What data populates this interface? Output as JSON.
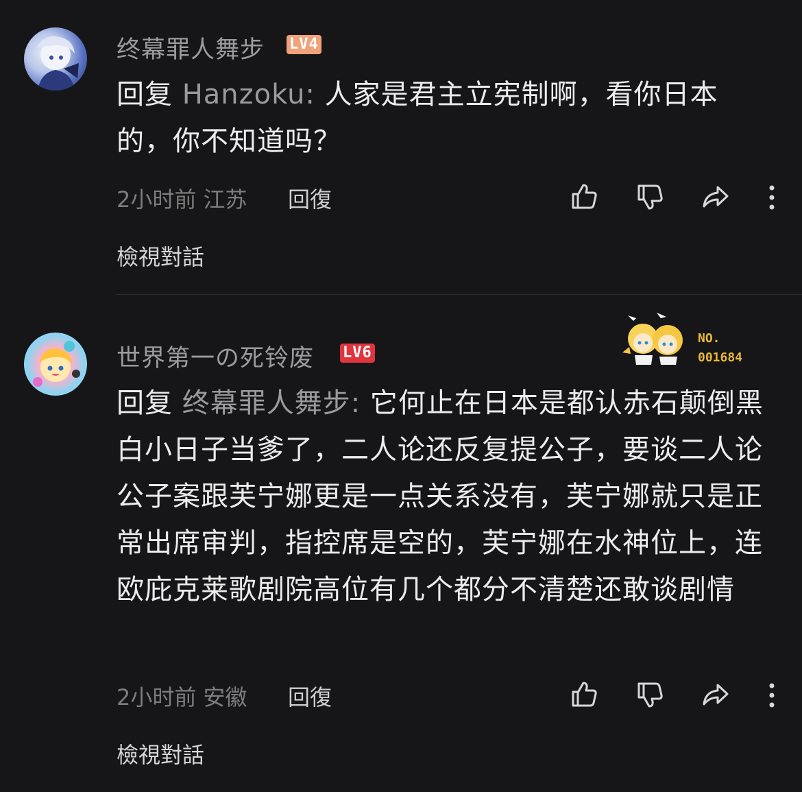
{
  "comments": [
    {
      "username": "终幕罪人舞步",
      "level": "LV4",
      "reply_prefix": "回复",
      "mention": "Hanzoku:",
      "text": "人家是君主立宪制啊，看你日本的，你不知道吗？",
      "time": "2小时前",
      "location": "江苏",
      "reply_label": "回復",
      "view_conversation": "檢視對話"
    },
    {
      "username": "世界第一の死铃废",
      "level": "LV6",
      "reply_prefix": "回复",
      "mention": "终幕罪人舞步:",
      "text": "它何止在日本是都认赤石颠倒黑白小日子当爹了，二人论还反复提公子，要谈二人论公子案跟芙宁娜更是一点关系没有，芙宁娜就只是正常出席审判，指控席是空的，芙宁娜在水神位上，连欧庇克莱歌剧院高位有几个都分不清楚还敢谈剧情",
      "time": "2小时前",
      "location": "安徽",
      "reply_label": "回復",
      "view_conversation": "檢視對話",
      "fan_badge": {
        "label": "NO.",
        "number": "001684"
      }
    }
  ],
  "icons": [
    "like-icon",
    "dislike-icon",
    "share-icon",
    "more-icon"
  ],
  "colors": {
    "background": "#161618",
    "username": "#9b9b9b",
    "text": "#ececec",
    "lv4": "#f0a27a",
    "lv6": "#e0343f",
    "fan_badge": "#e9b73a"
  }
}
